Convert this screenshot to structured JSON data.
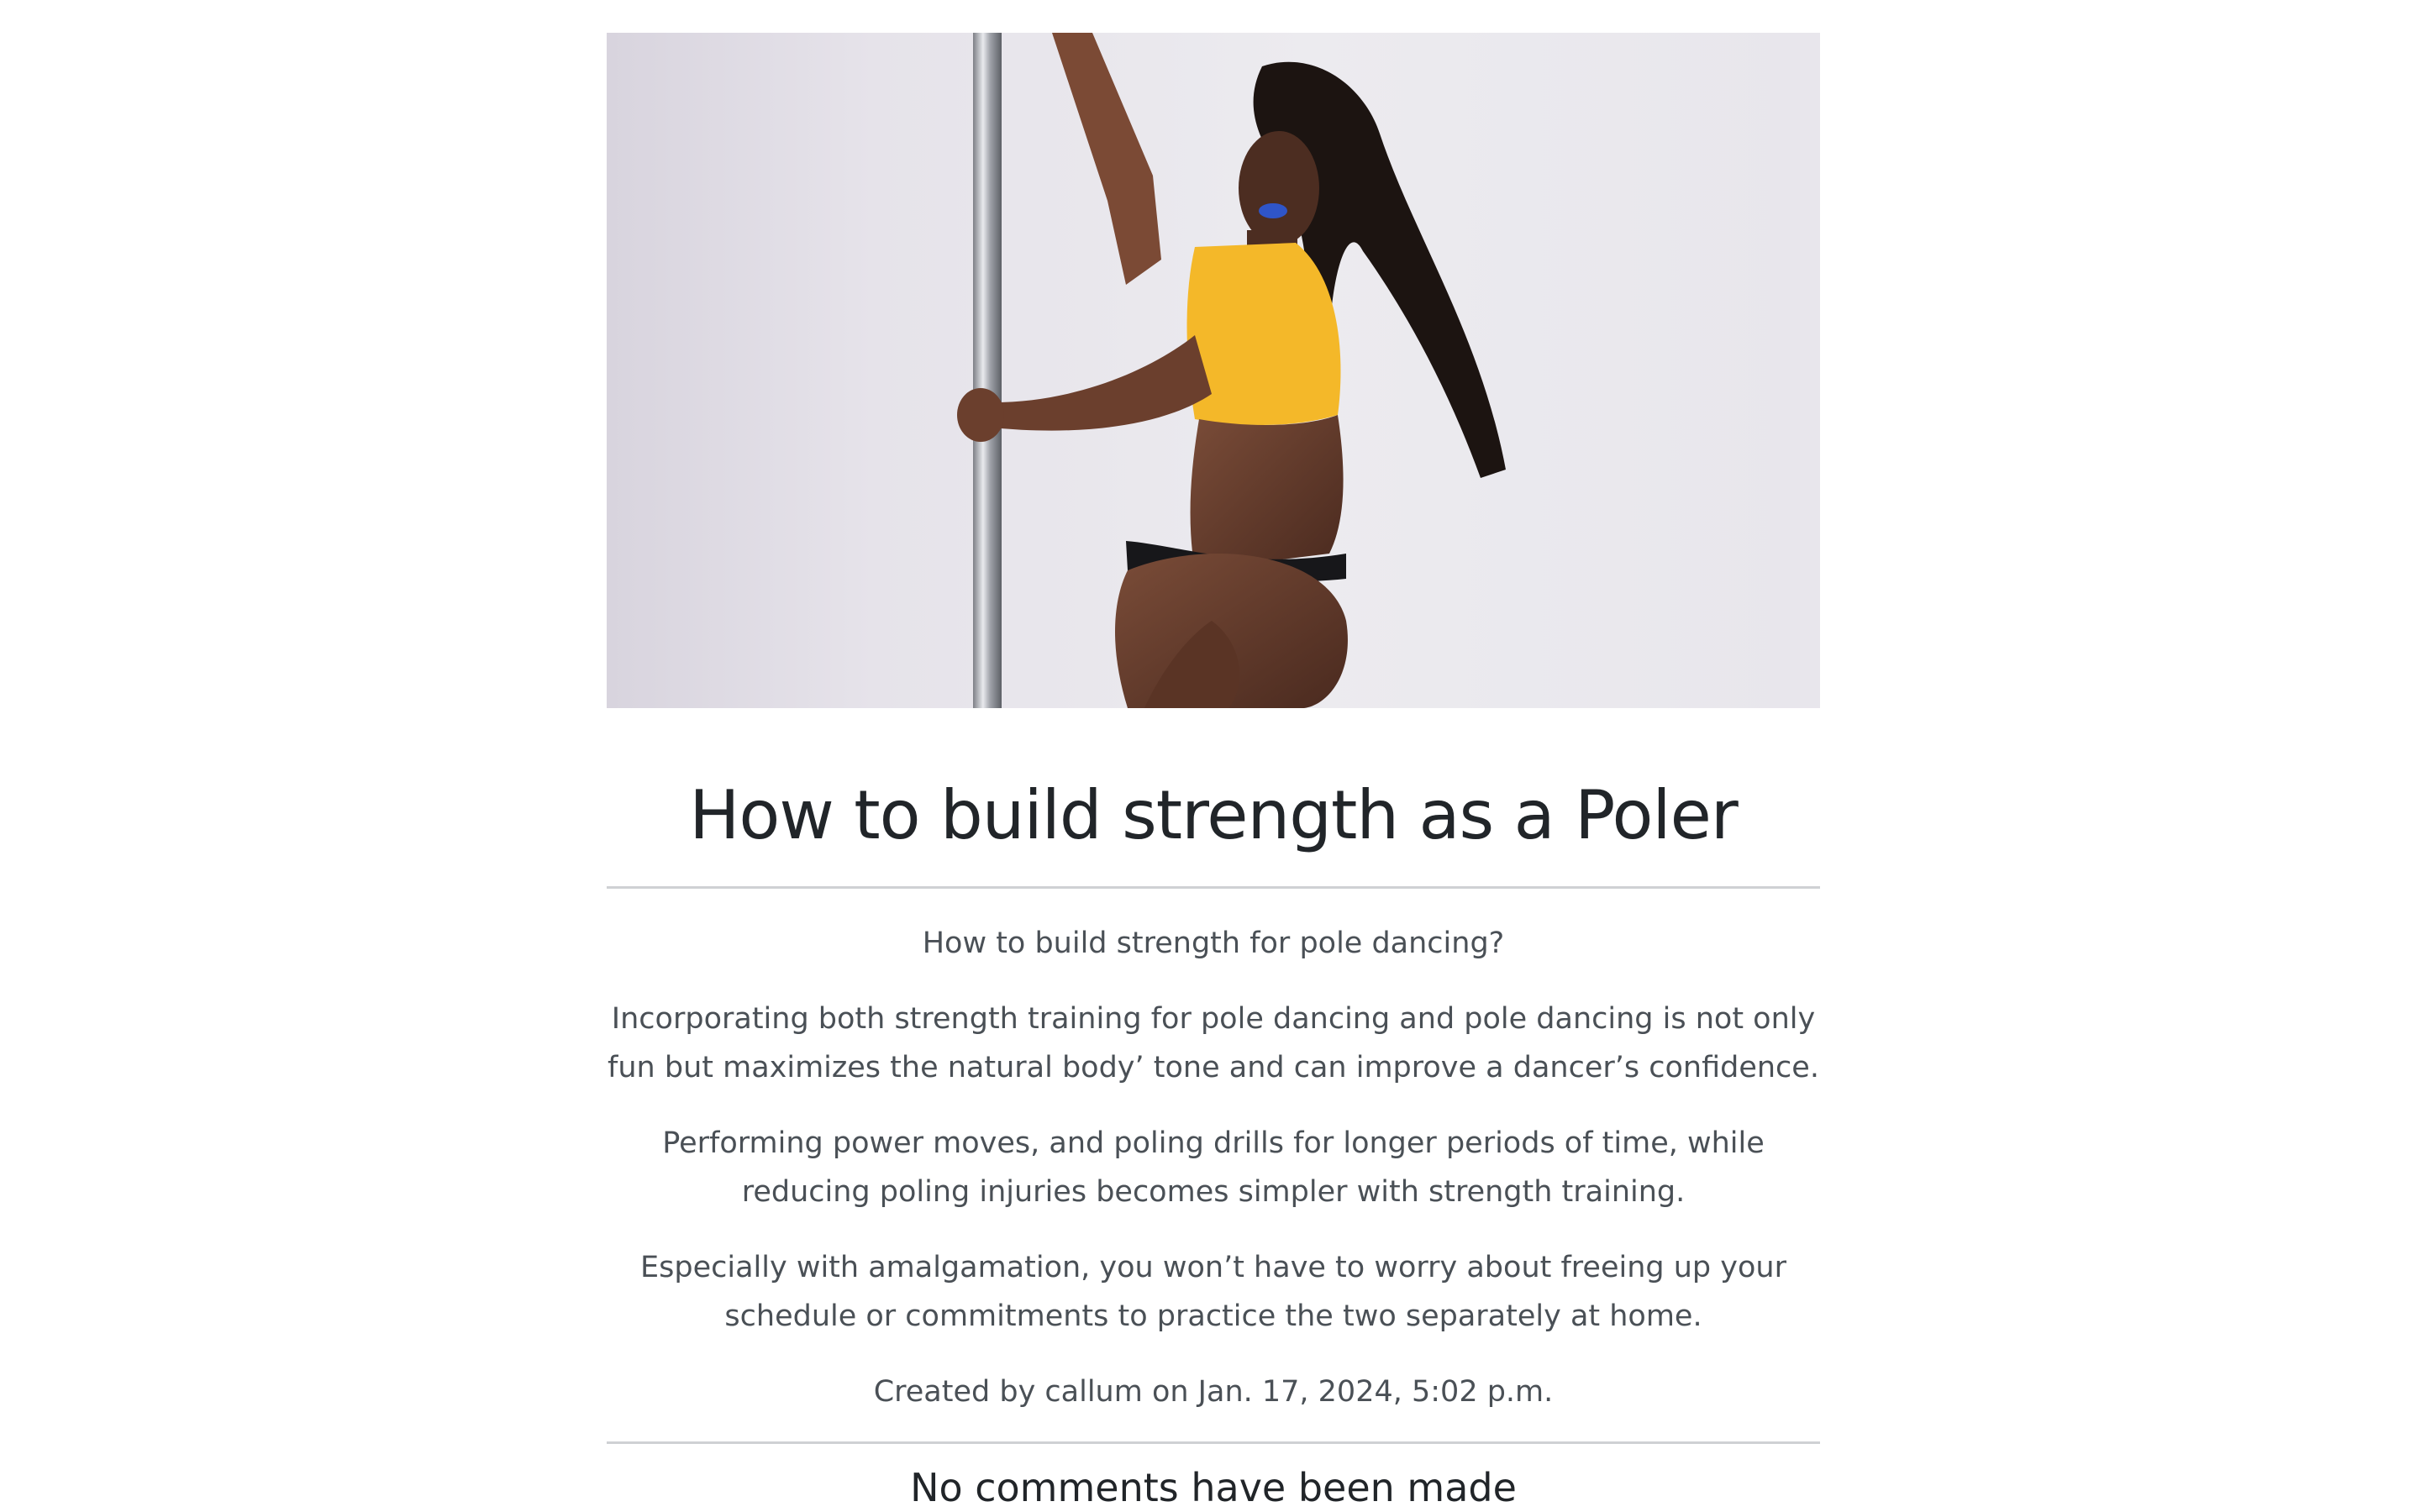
{
  "post": {
    "image": {
      "alt": "How to build strength as a Poler"
    },
    "title": "How to build strength as a Poler",
    "paragraphs": [
      "How to build strength for pole dancing?",
      "Incorporating both strength training for pole dancing and pole dancing is not only fun but maximizes the natural body’ tone and can improve a dancer’s confidence.",
      "Performing power moves, and poling drills for longer periods of time, while reducing poling injuries becomes simpler with strength training.",
      "Especially with amalgamation, you won’t have to worry about freeing up your schedule or commitments to practice the two separately at home."
    ],
    "meta": "Created by callum on Jan. 17, 2024, 5:02 p.m."
  },
  "comments": {
    "heading": "No comments have been made"
  },
  "colors": {
    "title": "#212529",
    "body_text": "#4a5056",
    "rule": "#cfd1d4",
    "top_yellow": "#f4b829",
    "lips_blue": "#2f55c8"
  }
}
